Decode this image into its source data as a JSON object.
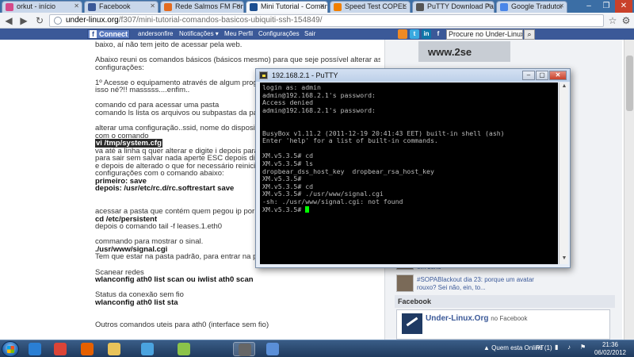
{
  "browser": {
    "tabs": [
      {
        "title": "orkut - início",
        "color": "#d54a8a"
      },
      {
        "title": "Facebook",
        "color": "#3b5998"
      },
      {
        "title": "Rede Salmos FM Fortal",
        "color": "#e36b1f"
      },
      {
        "title": "Mini Tutorial - Comand",
        "color": "#1d4f91"
      },
      {
        "title": "Speed Test COPEL",
        "color": "#f07f00"
      },
      {
        "title": "PuTTY Download Page",
        "color": "#555555"
      },
      {
        "title": "Google Tradutor",
        "color": "#4a86e8"
      }
    ],
    "active_tab": 3,
    "url_host": "under-linux.org",
    "url_path": "/f307/mini-tutorial-comandos-basicos-ubiquiti-ssh-154849/"
  },
  "site": {
    "connect_label": "Connect",
    "nav": [
      "andersonfire",
      "Notificações ▾",
      "Meu Perfil",
      "Configurações",
      "Sair"
    ],
    "search_placeholder": "Procure no Under-Linux.Org",
    "social": [
      {
        "name": "rss",
        "label": "",
        "color": "#f08a24"
      },
      {
        "name": "twitter",
        "label": "t",
        "color": "#39a9e0"
      },
      {
        "name": "linkedin",
        "label": "in",
        "color": "#0e76a8"
      },
      {
        "name": "facebook",
        "label": "f",
        "color": "#3b5998"
      }
    ]
  },
  "article": {
    "lines": [
      {
        "text": "baixo, aí não tem jeito de acessar pela web."
      },
      {
        "text": ""
      },
      {
        "text": "Abaixo reuni os comandos básicos (básicos mesmo) para que seje possível alterar as"
      },
      {
        "text": "configurações:"
      },
      {
        "text": ""
      },
      {
        "text": "1º Acesse o equipamento através de algum programa"
      },
      {
        "text": "isso né?!! masssss....enfim.."
      },
      {
        "text": ""
      },
      {
        "text": "comando cd para acessar uma pasta",
        "bold_word": "cd"
      },
      {
        "text": "comando ls lista os arquivos ou subpastas da pasta",
        "bold_word": "ls"
      },
      {
        "text": ""
      },
      {
        "text": "alterar uma configuração..ssid, nome do dispositivo,"
      },
      {
        "text": "com o comando"
      },
      {
        "text": "vi /tmp/system.cfg",
        "highlight": true
      },
      {
        "text": "va até a linha q quer alterar e digite i depois para sa"
      },
      {
        "text": "para sair sem salvar nada aperte ESC depois digite :"
      },
      {
        "text": "e depois de alterado o que for necessário reiniciar o"
      },
      {
        "text": "configurações com o comando abaixo:"
      },
      {
        "text": "primeiro: save",
        "bold": true
      },
      {
        "text": "depois: /usr/etc/rc.d/rc.softrestart save",
        "bold": true
      },
      {
        "text": ""
      },
      {
        "text": ""
      },
      {
        "text": "acessar a pasta que contém quem pegou ip por dhcp"
      },
      {
        "text": "cd /etc/persistent",
        "bold": true
      },
      {
        "text": "depois o comando tail -f leases.1.eth0"
      },
      {
        "text": ""
      },
      {
        "text": "commando para mostrar o sinal."
      },
      {
        "text": "./usr/www/signal.cgi",
        "bold": true
      },
      {
        "text": "Tem que estar na pasta padrão, para entrar na pasta"
      },
      {
        "text": ""
      },
      {
        "text": "Scanear redes"
      },
      {
        "text": "wlanconfig ath0 list scan ou iwlist ath0 scan",
        "bold": true
      },
      {
        "text": ""
      },
      {
        "text": "Status da conexão sem fio"
      },
      {
        "text": "wlanconfig ath0 list sta",
        "bold": true
      },
      {
        "text": ""
      },
      {
        "text": ""
      },
      {
        "text": "Outros comandos uteis para ath0 (interface sem fio)"
      }
    ]
  },
  "sidebar": {
    "ad_text": "www.2se",
    "posts": [
      {
        "text": "em série"
      },
      {
        "text": "#SOPABlackout dia 23: porque um avatar"
      },
      {
        "text": "rouxo? Sei não, ein, to..."
      }
    ],
    "facebook_heading": "Facebook",
    "fb_page_name": "Under-Linux.Org",
    "fb_page_suffix": "no Facebook"
  },
  "putty": {
    "title": "192.168.2.1 - PuTTY",
    "lines": [
      "login as: admin",
      "admin@192.168.2.1's password:",
      "Access denied",
      "admin@192.168.2.1's password:",
      "",
      "",
      "BusyBox v1.11.2 (2011-12-19 20:41:43 EET) built-in shell (ash)",
      "Enter 'help' for a list of built-in commands.",
      "",
      "XM.v5.3.5# cd",
      "XM.v5.3.5# ls",
      "dropbear_dss_host_key  dropbear_rsa_host_key",
      "XM.v5.3.5#",
      "XM.v5.3.5# cd",
      "XM.v5.3.5# ./usr/www/signal.cgi",
      "-sh: ./usr/www/signal.cgi: not found"
    ],
    "prompt": "XM.v5.3.5# "
  },
  "taskbar": {
    "apps": [
      {
        "name": "internet-explorer",
        "color": "#2a7fd4"
      },
      {
        "name": "chrome",
        "color": "#db4437"
      },
      {
        "name": "firefox",
        "color": "#e66000"
      },
      {
        "name": "explorer",
        "color": "#e8c35a"
      },
      {
        "name": "media",
        "color": "#4aa3df"
      },
      {
        "name": "app-a",
        "color": "#8bc34a"
      },
      {
        "name": "putty",
        "color": "#666666"
      },
      {
        "name": "paint",
        "color": "#5a8fd8"
      }
    ],
    "quem_esta_online": "Quem esta Online (1)",
    "language": "PT",
    "time": "21:36",
    "date": "06/02/2012"
  }
}
